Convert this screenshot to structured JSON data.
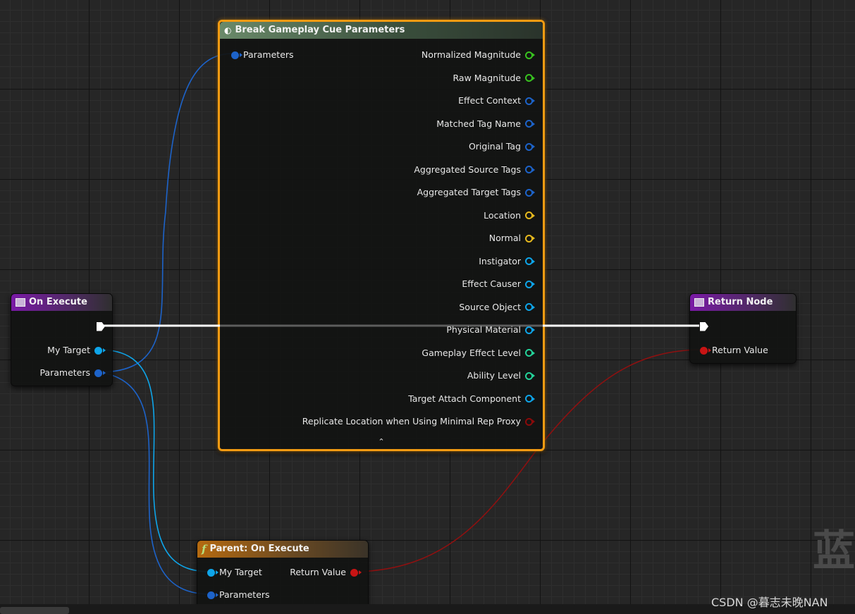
{
  "colors": {
    "struct_pin": "#1d63c9",
    "object_pin": "#0ea5e9",
    "float_pin": "#38c31f",
    "vector_pin": "#e6b91e",
    "int_pin": "#24d39a",
    "bool_pin": "#8a0a0a",
    "return_pin": "#c81414",
    "selection": "#f39b12"
  },
  "nodes": {
    "on_execute": {
      "title": "On Execute",
      "icon": "event-icon",
      "outputs": [
        {
          "label": "My Target",
          "type": "object"
        },
        {
          "label": "Parameters",
          "type": "struct"
        }
      ]
    },
    "break": {
      "title": "Break Gameplay Cue Parameters",
      "icon": "break-struct-icon",
      "input": {
        "label": "Parameters",
        "type": "struct"
      },
      "outputs": [
        {
          "label": "Normalized Magnitude",
          "type": "float"
        },
        {
          "label": "Raw Magnitude",
          "type": "float"
        },
        {
          "label": "Effect Context",
          "type": "struct"
        },
        {
          "label": "Matched Tag Name",
          "type": "struct"
        },
        {
          "label": "Original Tag",
          "type": "struct"
        },
        {
          "label": "Aggregated Source Tags",
          "type": "struct"
        },
        {
          "label": "Aggregated Target Tags",
          "type": "struct"
        },
        {
          "label": "Location",
          "type": "vector"
        },
        {
          "label": "Normal",
          "type": "vector"
        },
        {
          "label": "Instigator",
          "type": "object"
        },
        {
          "label": "Effect Causer",
          "type": "object"
        },
        {
          "label": "Source Object",
          "type": "object"
        },
        {
          "label": "Physical Material",
          "type": "object"
        },
        {
          "label": "Gameplay Effect Level",
          "type": "int"
        },
        {
          "label": "Ability Level",
          "type": "int"
        },
        {
          "label": "Target Attach Component",
          "type": "object"
        },
        {
          "label": "Replicate Location when Using Minimal Rep Proxy",
          "type": "bool"
        }
      ],
      "collapse_icon": "chevron-up-icon"
    },
    "return_node": {
      "title": "Return Node",
      "icon": "event-icon",
      "input": {
        "label": "Return Value",
        "type": "return"
      }
    },
    "parent": {
      "title": "Parent: On Execute",
      "icon": "function-icon",
      "icon_glyph": "f",
      "inputs": [
        {
          "label": "My Target",
          "type": "object"
        },
        {
          "label": "Parameters",
          "type": "struct"
        }
      ],
      "output": {
        "label": "Return Value",
        "type": "return"
      }
    }
  },
  "watermark": {
    "char": "蓝",
    "text": "CSDN @暮志未晚NAN"
  }
}
